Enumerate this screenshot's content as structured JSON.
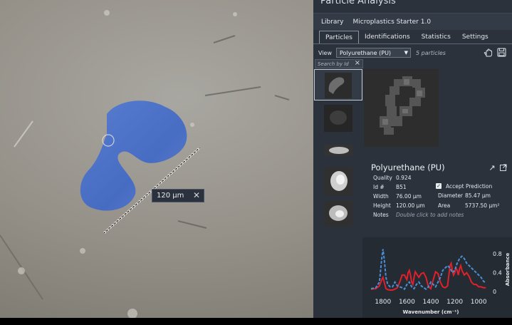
{
  "app": {
    "title": "Particle Analysis"
  },
  "measurement": {
    "label": "120 µm"
  },
  "library": {
    "label": "Library",
    "value": "Microplastics Starter 1.0"
  },
  "tabs": [
    {
      "label": "Particles"
    },
    {
      "label": "Identifications"
    },
    {
      "label": "Statistics"
    },
    {
      "label": "Settings"
    }
  ],
  "view": {
    "label": "View",
    "selected": "Polyurethane (PU)",
    "count": "5 particles"
  },
  "search": {
    "placeholder": "Search by Id"
  },
  "particle": {
    "name": "Polyurethane (PU)",
    "quality_label": "Quality",
    "quality": "0.924",
    "id_label": "Id #",
    "id": "B51",
    "width_label": "Width",
    "width": "76.00 µm",
    "height_label": "Height",
    "height": "120.00 µm",
    "notes_label": "Notes",
    "notes_placeholder": "Double click to add notes",
    "accept_label": "Accept Prediction",
    "diameter_label": "Diameter",
    "diameter": "85.47 µm",
    "area_label": "Area",
    "area": "5737.50 µm²"
  },
  "icons": {
    "hand": "hand-cursor-icon",
    "save": "floppy-disk-icon",
    "expand": "expand-arrow-icon",
    "popout": "open-external-icon"
  },
  "colors": {
    "measured": "#e0202a",
    "reference": "#4a8fd6"
  },
  "chart_data": {
    "type": "line",
    "xlabel": "Wavenumber (cm⁻¹)",
    "ylabel": "Absorbance",
    "xlim": [
      1900,
      900
    ],
    "ylim": [
      0,
      1.0
    ],
    "x_ticks": [
      "1800",
      "1600",
      "1400",
      "1200",
      "1000"
    ],
    "y_ticks": [
      "0",
      "0.4",
      "0.8"
    ],
    "series": [
      {
        "x": [
          1900,
          1860,
          1830,
          1810,
          1800,
          1790,
          1775,
          1760,
          1740,
          1720,
          1700,
          1680,
          1660,
          1640,
          1620,
          1600,
          1590,
          1580,
          1570,
          1560,
          1550,
          1540,
          1530,
          1520,
          1500,
          1480,
          1460,
          1440,
          1420,
          1400,
          1380,
          1360,
          1340,
          1320,
          1300,
          1280,
          1260,
          1240,
          1230,
          1220,
          1210,
          1200,
          1190,
          1180,
          1170,
          1160,
          1150,
          1140,
          1120,
          1100,
          1080,
          1060,
          1040,
          1020,
          1000,
          980,
          960,
          940
        ],
        "y": [
          0.05,
          0.06,
          0.12,
          0.25,
          0.3,
          0.2,
          0.06,
          0.04,
          0.03,
          0.03,
          0.05,
          0.08,
          0.2,
          0.35,
          0.35,
          0.25,
          0.4,
          0.45,
          0.35,
          0.2,
          0.15,
          0.3,
          0.42,
          0.38,
          0.3,
          0.38,
          0.4,
          0.3,
          0.1,
          0.06,
          0.25,
          0.42,
          0.38,
          0.2,
          0.1,
          0.08,
          0.12,
          0.55,
          0.6,
          0.45,
          0.35,
          0.4,
          0.5,
          0.45,
          0.35,
          0.48,
          0.55,
          0.45,
          0.35,
          0.4,
          0.32,
          0.2,
          0.15,
          0.15,
          0.1,
          0.1,
          0.08,
          0.08
        ]
      },
      {
        "x": [
          1900,
          1860,
          1830,
          1810,
          1800,
          1790,
          1775,
          1760,
          1740,
          1720,
          1700,
          1680,
          1660,
          1640,
          1620,
          1600,
          1580,
          1560,
          1540,
          1520,
          1500,
          1480,
          1460,
          1440,
          1420,
          1400,
          1380,
          1360,
          1340,
          1320,
          1300,
          1280,
          1260,
          1240,
          1220,
          1200,
          1180,
          1160,
          1140,
          1120,
          1100,
          1080,
          1060,
          1040,
          1020,
          1000,
          980,
          960,
          940
        ],
        "y": [
          0.06,
          0.08,
          0.2,
          0.7,
          0.9,
          0.7,
          0.3,
          0.15,
          0.1,
          0.1,
          0.2,
          0.12,
          0.1,
          0.08,
          0.05,
          0.15,
          0.2,
          0.1,
          0.06,
          0.15,
          0.2,
          0.12,
          0.08,
          0.05,
          0.1,
          0.2,
          0.15,
          0.1,
          0.2,
          0.3,
          0.45,
          0.5,
          0.55,
          0.5,
          0.4,
          0.45,
          0.6,
          0.7,
          0.75,
          0.7,
          0.6,
          0.55,
          0.5,
          0.45,
          0.4,
          0.35,
          0.3,
          0.22,
          0.18
        ]
      }
    ]
  }
}
